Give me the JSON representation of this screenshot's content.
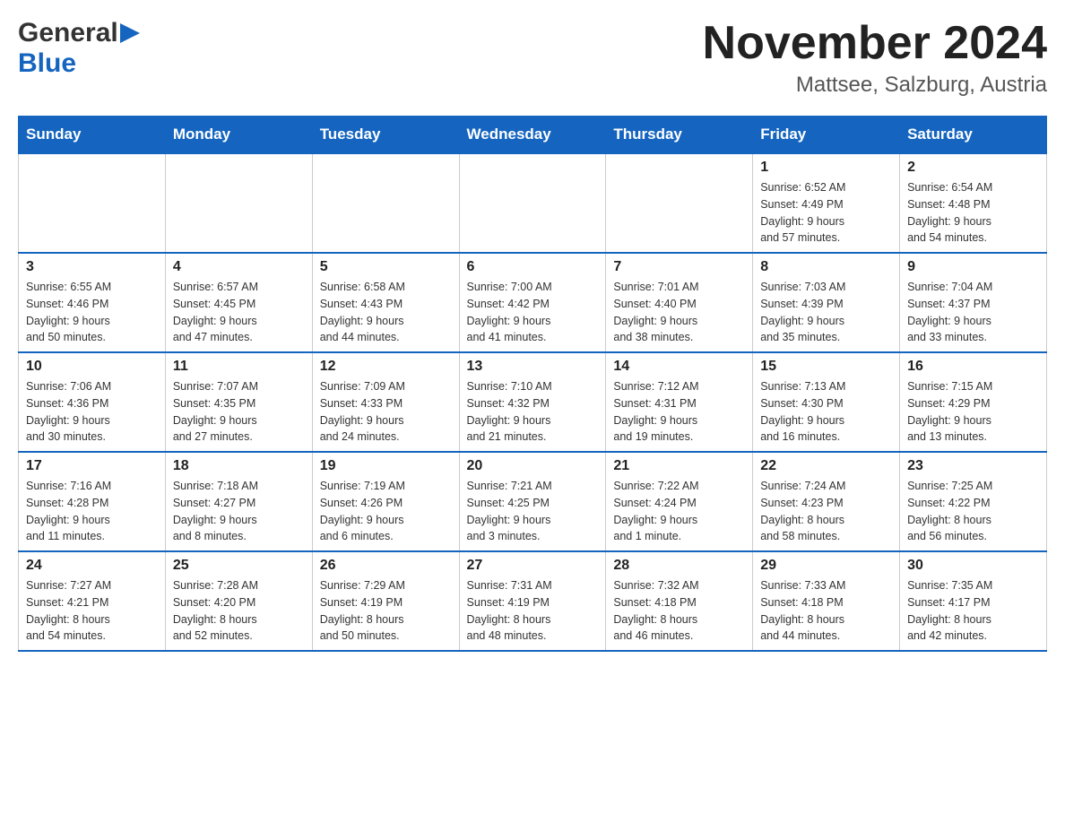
{
  "header": {
    "logo_general": "General",
    "logo_blue": "Blue",
    "title": "November 2024",
    "location": "Mattsee, Salzburg, Austria"
  },
  "weekdays": [
    "Sunday",
    "Monday",
    "Tuesday",
    "Wednesday",
    "Thursday",
    "Friday",
    "Saturday"
  ],
  "weeks": [
    [
      {
        "day": "",
        "info": ""
      },
      {
        "day": "",
        "info": ""
      },
      {
        "day": "",
        "info": ""
      },
      {
        "day": "",
        "info": ""
      },
      {
        "day": "",
        "info": ""
      },
      {
        "day": "1",
        "info": "Sunrise: 6:52 AM\nSunset: 4:49 PM\nDaylight: 9 hours\nand 57 minutes."
      },
      {
        "day": "2",
        "info": "Sunrise: 6:54 AM\nSunset: 4:48 PM\nDaylight: 9 hours\nand 54 minutes."
      }
    ],
    [
      {
        "day": "3",
        "info": "Sunrise: 6:55 AM\nSunset: 4:46 PM\nDaylight: 9 hours\nand 50 minutes."
      },
      {
        "day": "4",
        "info": "Sunrise: 6:57 AM\nSunset: 4:45 PM\nDaylight: 9 hours\nand 47 minutes."
      },
      {
        "day": "5",
        "info": "Sunrise: 6:58 AM\nSunset: 4:43 PM\nDaylight: 9 hours\nand 44 minutes."
      },
      {
        "day": "6",
        "info": "Sunrise: 7:00 AM\nSunset: 4:42 PM\nDaylight: 9 hours\nand 41 minutes."
      },
      {
        "day": "7",
        "info": "Sunrise: 7:01 AM\nSunset: 4:40 PM\nDaylight: 9 hours\nand 38 minutes."
      },
      {
        "day": "8",
        "info": "Sunrise: 7:03 AM\nSunset: 4:39 PM\nDaylight: 9 hours\nand 35 minutes."
      },
      {
        "day": "9",
        "info": "Sunrise: 7:04 AM\nSunset: 4:37 PM\nDaylight: 9 hours\nand 33 minutes."
      }
    ],
    [
      {
        "day": "10",
        "info": "Sunrise: 7:06 AM\nSunset: 4:36 PM\nDaylight: 9 hours\nand 30 minutes."
      },
      {
        "day": "11",
        "info": "Sunrise: 7:07 AM\nSunset: 4:35 PM\nDaylight: 9 hours\nand 27 minutes."
      },
      {
        "day": "12",
        "info": "Sunrise: 7:09 AM\nSunset: 4:33 PM\nDaylight: 9 hours\nand 24 minutes."
      },
      {
        "day": "13",
        "info": "Sunrise: 7:10 AM\nSunset: 4:32 PM\nDaylight: 9 hours\nand 21 minutes."
      },
      {
        "day": "14",
        "info": "Sunrise: 7:12 AM\nSunset: 4:31 PM\nDaylight: 9 hours\nand 19 minutes."
      },
      {
        "day": "15",
        "info": "Sunrise: 7:13 AM\nSunset: 4:30 PM\nDaylight: 9 hours\nand 16 minutes."
      },
      {
        "day": "16",
        "info": "Sunrise: 7:15 AM\nSunset: 4:29 PM\nDaylight: 9 hours\nand 13 minutes."
      }
    ],
    [
      {
        "day": "17",
        "info": "Sunrise: 7:16 AM\nSunset: 4:28 PM\nDaylight: 9 hours\nand 11 minutes."
      },
      {
        "day": "18",
        "info": "Sunrise: 7:18 AM\nSunset: 4:27 PM\nDaylight: 9 hours\nand 8 minutes."
      },
      {
        "day": "19",
        "info": "Sunrise: 7:19 AM\nSunset: 4:26 PM\nDaylight: 9 hours\nand 6 minutes."
      },
      {
        "day": "20",
        "info": "Sunrise: 7:21 AM\nSunset: 4:25 PM\nDaylight: 9 hours\nand 3 minutes."
      },
      {
        "day": "21",
        "info": "Sunrise: 7:22 AM\nSunset: 4:24 PM\nDaylight: 9 hours\nand 1 minute."
      },
      {
        "day": "22",
        "info": "Sunrise: 7:24 AM\nSunset: 4:23 PM\nDaylight: 8 hours\nand 58 minutes."
      },
      {
        "day": "23",
        "info": "Sunrise: 7:25 AM\nSunset: 4:22 PM\nDaylight: 8 hours\nand 56 minutes."
      }
    ],
    [
      {
        "day": "24",
        "info": "Sunrise: 7:27 AM\nSunset: 4:21 PM\nDaylight: 8 hours\nand 54 minutes."
      },
      {
        "day": "25",
        "info": "Sunrise: 7:28 AM\nSunset: 4:20 PM\nDaylight: 8 hours\nand 52 minutes."
      },
      {
        "day": "26",
        "info": "Sunrise: 7:29 AM\nSunset: 4:19 PM\nDaylight: 8 hours\nand 50 minutes."
      },
      {
        "day": "27",
        "info": "Sunrise: 7:31 AM\nSunset: 4:19 PM\nDaylight: 8 hours\nand 48 minutes."
      },
      {
        "day": "28",
        "info": "Sunrise: 7:32 AM\nSunset: 4:18 PM\nDaylight: 8 hours\nand 46 minutes."
      },
      {
        "day": "29",
        "info": "Sunrise: 7:33 AM\nSunset: 4:18 PM\nDaylight: 8 hours\nand 44 minutes."
      },
      {
        "day": "30",
        "info": "Sunrise: 7:35 AM\nSunset: 4:17 PM\nDaylight: 8 hours\nand 42 minutes."
      }
    ]
  ]
}
